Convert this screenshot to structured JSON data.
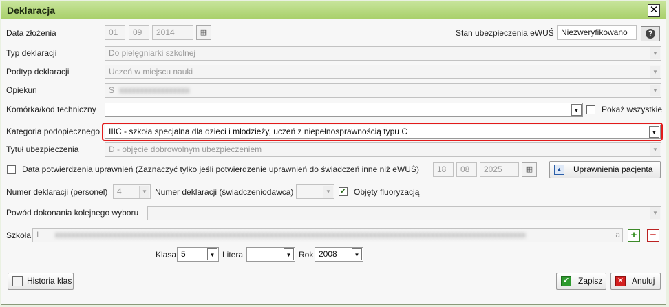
{
  "window": {
    "title": "Deklaracja"
  },
  "data_zlozenia": {
    "label": "Data złożenia",
    "day": "01",
    "month": "09",
    "year": "2014"
  },
  "ewus": {
    "label": "Stan ubezpieczenia eWUŚ",
    "value": "Niezweryfikowano",
    "help_glyph": "?"
  },
  "typ_deklaracji": {
    "label": "Typ deklaracji",
    "value": "Do pielęgniarki szkolnej"
  },
  "podtyp": {
    "label": "Podtyp deklaracji",
    "value": "Uczeń w miejscu nauki"
  },
  "opiekun": {
    "label": "Opiekun",
    "value": "S"
  },
  "komorka": {
    "label": "Komórka/kod techniczny",
    "value": "",
    "show_all_label": "Pokaż wszystkie"
  },
  "kategoria": {
    "label": "Kategoria podopiecznego",
    "value": "IIIC - szkoła specjalna dla dzieci i młodzieży, uczeń z niepełnosprawnością typu C"
  },
  "tytul": {
    "label": "Tytuł ubezpieczenia",
    "value": "D - objęcie dobrowolnym ubezpieczeniem"
  },
  "potwierdzenie": {
    "label": "Data potwierdzenia uprawnień (Zaznaczyć tylko jeśli potwierdzenie uprawnień do świadczeń inne niż eWUŚ)",
    "day": "18",
    "month": "08",
    "year": "2025",
    "button_label": "Uprawnienia pacjenta"
  },
  "numer_personel": {
    "label": "Numer deklaracji (personel)",
    "value": "4"
  },
  "numer_swiad": {
    "label": "Numer deklaracji (świadczeniodawca)",
    "value": ""
  },
  "fluoryzacja": {
    "label": "Objęty fluoryzacją",
    "checked": true
  },
  "powod": {
    "label": "Powód dokonania kolejnego wyboru",
    "value": ""
  },
  "szkola": {
    "label": "Szkoła",
    "value": "I",
    "suffix": "a",
    "add_glyph": "+",
    "remove_glyph": "−"
  },
  "klasa": {
    "label": "Klasa",
    "value": "5"
  },
  "litera": {
    "label": "Litera",
    "value": ""
  },
  "rok": {
    "label": "Rok",
    "value": "2008"
  },
  "buttons": {
    "historia": "Historia klas",
    "zapisz": "Zapisz",
    "anuluj": "Anuluj"
  },
  "colors": {
    "title_bar": "#b5d97e",
    "highlight": "#e31b1b"
  }
}
